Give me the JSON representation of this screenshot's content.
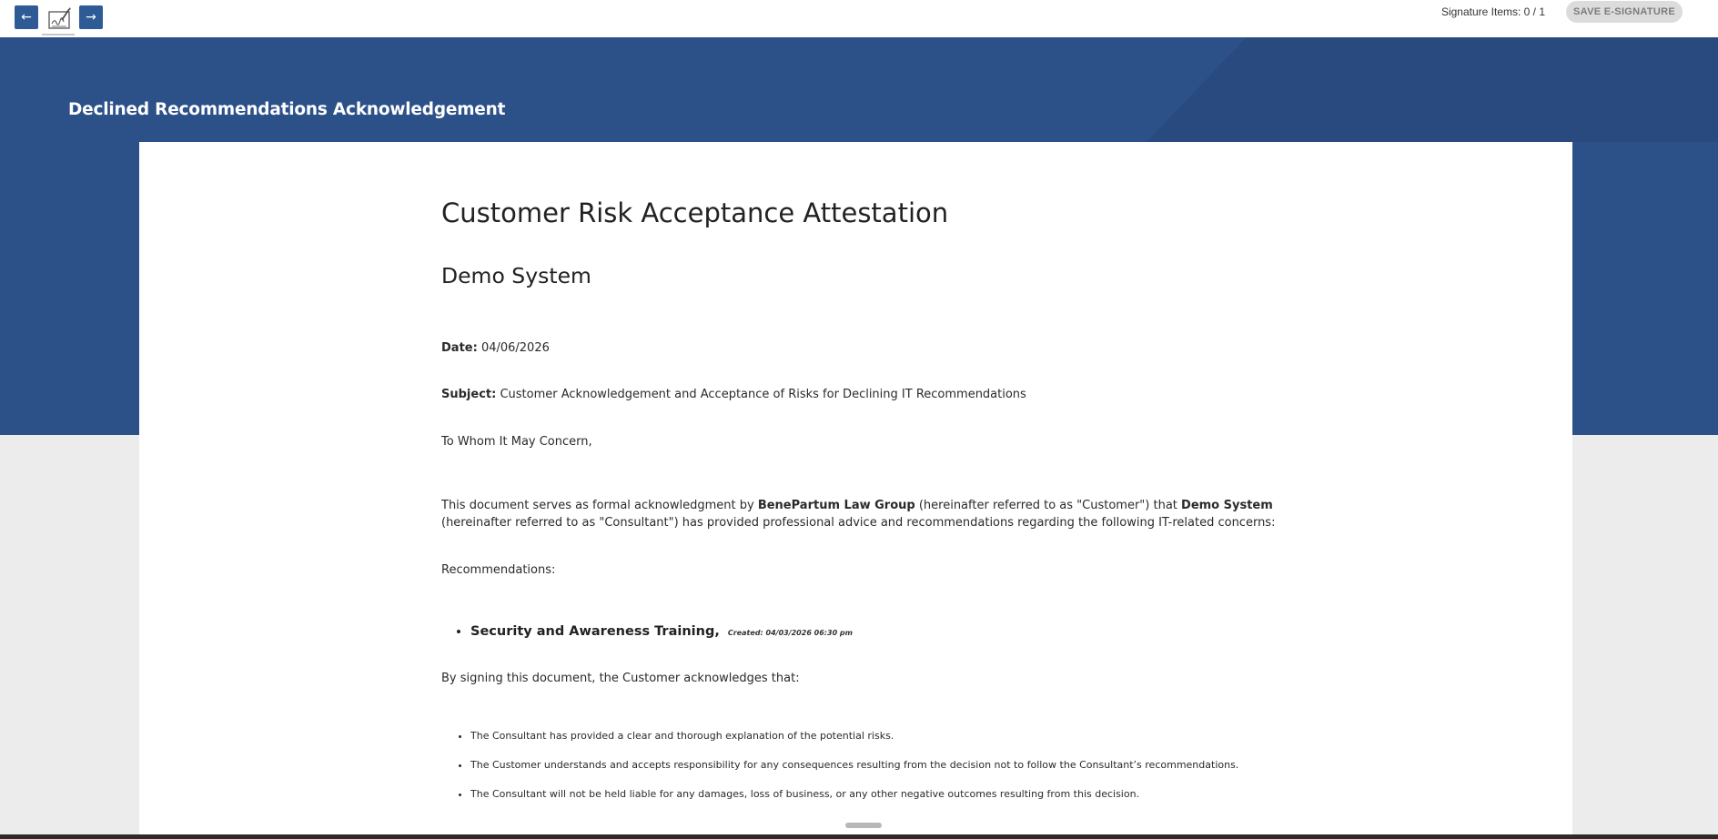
{
  "toolbar": {
    "prev_icon": "arrow-left-icon",
    "next_icon": "arrow-right-icon",
    "signature_tool_icon": "signature-pad-icon",
    "signature_items_label": "Signature Items: 0 / 1",
    "save_label": "SAVE E-SIGNATURE"
  },
  "header": {
    "title": "Declined Recommendations Acknowledgement"
  },
  "document": {
    "title": "Customer Risk Acceptance Attestation",
    "subtitle": "Demo System",
    "date_label": "Date:",
    "date_value": "04/06/2026",
    "subject_label": "Subject:",
    "subject_value": "Customer Acknowledgement and Acceptance of Risks for Declining IT Recommendations",
    "greeting": "To Whom It May Concern,",
    "intro": {
      "part1": "This document serves as formal acknowledgment by ",
      "customer_name": "BenePartum Law Group",
      "part2": " (hereinafter referred to as \"Customer\") that ",
      "consultant_name": "Demo System",
      "part3": " (hereinafter referred to as \"Consultant\") has provided professional advice and recommendations regarding the following IT-related concerns:"
    },
    "recommendations_heading": "Recommendations:",
    "recommendations": [
      {
        "name": "Security and Awareness Training,",
        "created": "Created: 04/03/2026 06:30 pm"
      }
    ],
    "acknowledgement_heading": "By signing this document, the Customer acknowledges that:",
    "acknowledgements": [
      "The Consultant has provided a clear and thorough explanation of the potential risks.",
      "The Customer understands and accepts responsibility for any consequences resulting from the decision not to follow the Consultant’s recommendations.",
      "The Consultant will not be held liable for any damages, loss of business, or any other negative outcomes resulting from this decision."
    ]
  },
  "colors": {
    "header_blue": "#2c5088",
    "button_blue": "#2e5a96",
    "grey_bg": "#ececec"
  }
}
